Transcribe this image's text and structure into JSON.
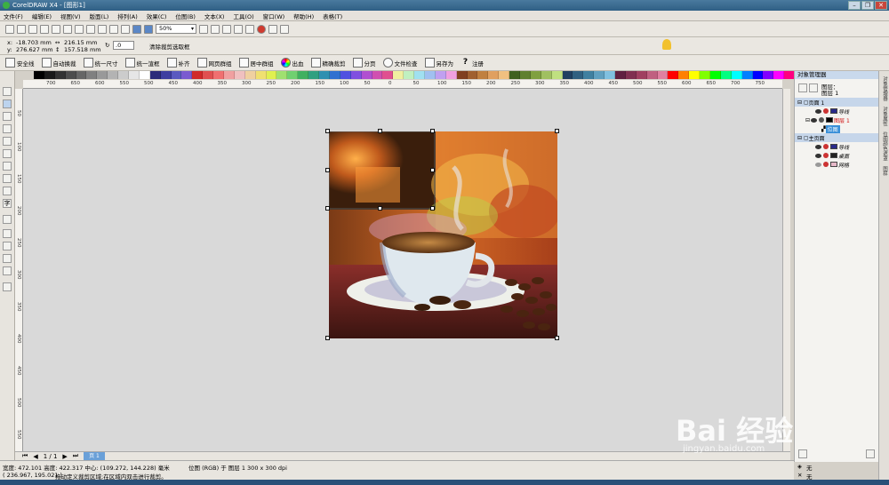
{
  "window": {
    "title": "CorelDRAW X4 - [图形1]",
    "buttons": [
      "–",
      "❐",
      "✕"
    ]
  },
  "menu": [
    "文件(F)",
    "编辑(E)",
    "视图(V)",
    "版面(L)",
    "排列(A)",
    "效果(C)",
    "位图(B)",
    "文本(X)",
    "工具(O)",
    "窗口(W)",
    "帮助(H)",
    "表格(T)"
  ],
  "toolbar": {
    "zoom": "50%"
  },
  "props": {
    "x": "-18.703 mm",
    "y": "276.627 mm",
    "w": "216.15 mm",
    "h": "157.518 mm",
    "angle": ".0",
    "clear_crop": "清除裁剪选取框"
  },
  "plugins": [
    "安全线",
    "自动换裁",
    "统一尺寸",
    "统一渲框",
    "补齐",
    "网页群组",
    "居中群组",
    "出血",
    "精确裁剪",
    "分页",
    "文件检查",
    "另存为",
    "注册"
  ],
  "ruler_h": [
    "700",
    "650",
    "600",
    "550",
    "500",
    "450",
    "400",
    "350",
    "300",
    "250",
    "200",
    "150",
    "100",
    "50",
    "0",
    "50",
    "100",
    "150",
    "200",
    "250",
    "300",
    "350",
    "400",
    "450",
    "500",
    "550",
    "600",
    "650",
    "700",
    "750"
  ],
  "ruler_v": [
    "50",
    "100",
    "150",
    "200",
    "250",
    "300",
    "350",
    "400",
    "450",
    "500",
    "550"
  ],
  "colors": {
    "accent": "#3a8fd8",
    "title_bar": "#3a6a92"
  },
  "palette": [
    "#000000",
    "#1a1a1a",
    "#333333",
    "#4d4d4d",
    "#666666",
    "#808080",
    "#999999",
    "#b3b3b3",
    "#cccccc",
    "#e6e6e6",
    "#ffffff",
    "#2b2b7a",
    "#3e3ea0",
    "#5a5ac0",
    "#7a5ad0",
    "#d02a2a",
    "#e05050",
    "#f07070",
    "#f0a0a0",
    "#f0c0c0",
    "#f0d0a0",
    "#f0e070",
    "#e0f050",
    "#a0e070",
    "#70d070",
    "#40b060",
    "#30a080",
    "#3090b0",
    "#3070d0",
    "#5050e0",
    "#8050e0",
    "#b050d0",
    "#d050b0",
    "#e05090",
    "#f0f0a0",
    "#c0f0c0",
    "#a0e0f0",
    "#a0c0f0",
    "#c0a0f0",
    "#f0a0e0",
    "#804020",
    "#a06030",
    "#c08040",
    "#e0a060",
    "#f0c080",
    "#406020",
    "#608030",
    "#80a040",
    "#a0c060",
    "#c0e080",
    "#204060",
    "#306080",
    "#4080a0",
    "#60a0c0",
    "#80c0e0",
    "#602040",
    "#803050",
    "#a04060",
    "#c06080",
    "#e080a0",
    "#ff0000",
    "#ff8000",
    "#ffff00",
    "#80ff00",
    "#00ff00",
    "#00ff80",
    "#00ffff",
    "#0080ff",
    "#0000ff",
    "#8000ff",
    "#ff00ff",
    "#ff0080"
  ],
  "page_nav": {
    "pages": "1 / 1",
    "tab": "页 1"
  },
  "status": {
    "line1": "宽度: 472.101 高度: 422.317 中心: (109.272, 144.228) 毫米",
    "line2": "( 236.967, 195.021 )",
    "hint": "拖动定义裁剪区域;在区域内双击进行裁剪。",
    "bitmap": "位图 (RGB) 于 图层 1 300 x 300 dpi",
    "fill": "无",
    "outline": "无"
  },
  "object_manager": {
    "title": "对象管理器",
    "top_labels": [
      "图层：",
      "图层 1"
    ],
    "page1": "页面 1",
    "guides": "导线",
    "layer1": "图层 1",
    "bitmap": "位图",
    "master": "主页面",
    "master_guides": "导线",
    "desktop": "桌面",
    "grid": "网格"
  },
  "dock_tabs": [
    "对象管理器",
    "对象属性",
    "位图颜色遮罩",
    "图样"
  ],
  "watermark": "Bai 经验",
  "watermark_sub": "jingyan.baidu.com"
}
